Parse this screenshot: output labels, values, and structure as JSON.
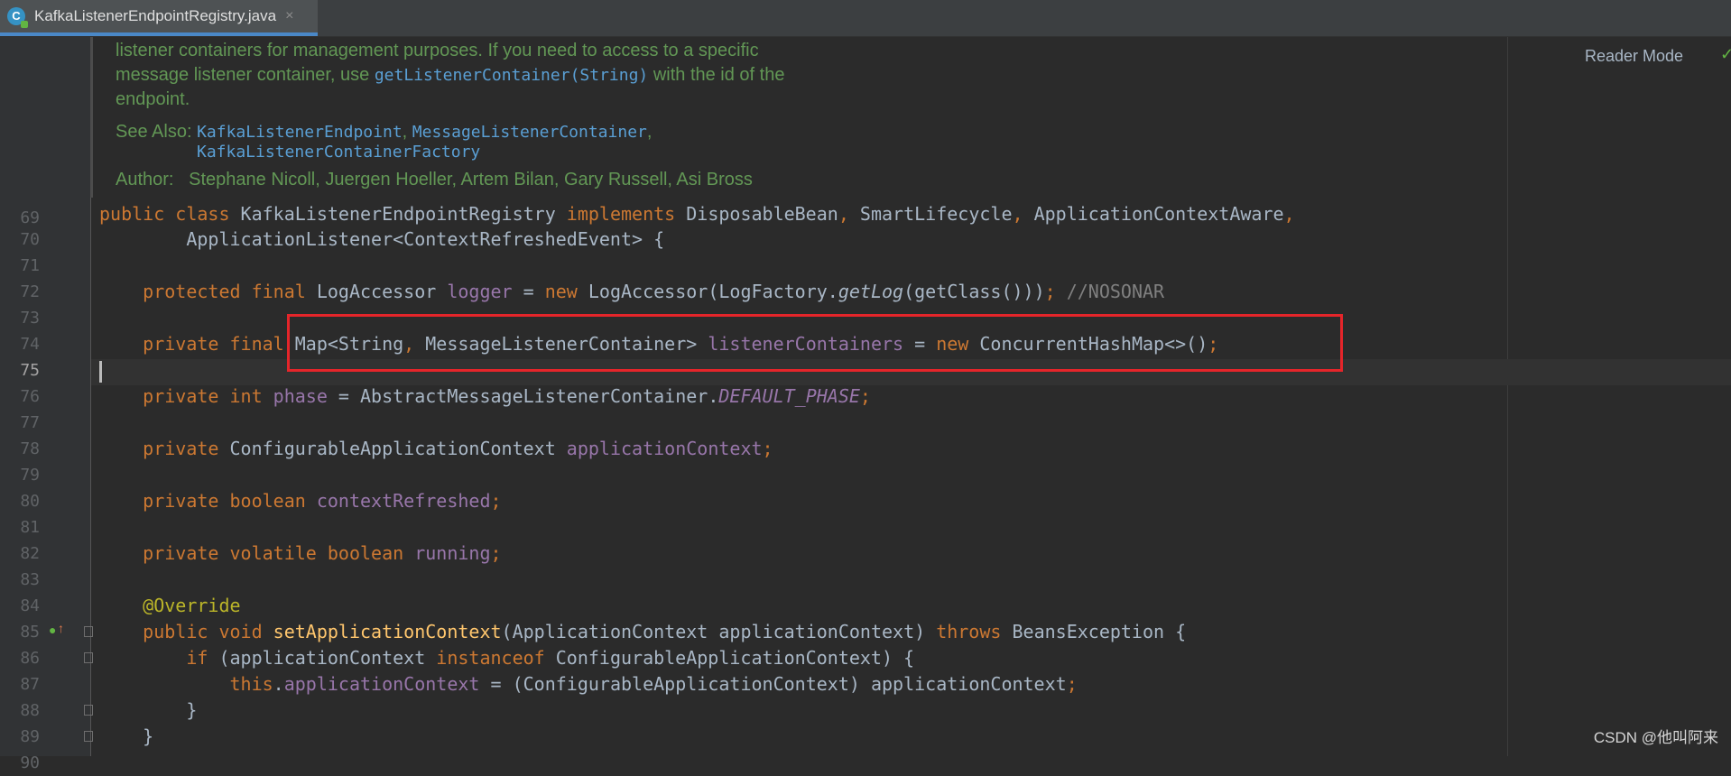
{
  "tab": {
    "icon_letter": "C",
    "title": "KafkaListenerEndpointRegistry.java",
    "close": "×"
  },
  "reader_mode": "Reader Mode",
  "javadoc": {
    "line1": "listener containers for management purposes. If you need to access to a specific",
    "line2_pre": "message listener container, use ",
    "line2_code": "getListenerContainer(String)",
    "line2_post": " with the id of the",
    "line3": "endpoint.",
    "see_also_label": "See Also:",
    "see_also_1": "KafkaListenerEndpoint",
    "see_also_sep1": ", ",
    "see_also_2": "MessageListenerContainer",
    "see_also_sep2": ",",
    "see_also_3": "KafkaListenerContainerFactory",
    "author_label": "Author:",
    "author_value": "Stephane Nicoll, Juergen Hoeller, Artem Bilan, Gary Russell, Asi Bross"
  },
  "line_numbers": [
    "69",
    "70",
    "71",
    "72",
    "73",
    "74",
    "75",
    "76",
    "77",
    "78",
    "79",
    "80",
    "81",
    "82",
    "83",
    "84",
    "85",
    "86",
    "87",
    "88",
    "89",
    "90"
  ],
  "code": {
    "l69": {
      "kw1": "public class ",
      "name": "KafkaListenerEndpointRegistry ",
      "kw2": "implements ",
      "t1": "DisposableBean",
      "c1": ", ",
      "t2": "SmartLifecycle",
      "c2": ", ",
      "t3": "ApplicationContextAware",
      "c3": ","
    },
    "l70": {
      "text": "ApplicationListener<ContextRefreshedEvent> {"
    },
    "l72": {
      "kw": "protected final ",
      "type": "LogAccessor ",
      "field": "logger",
      "eq": " = ",
      "kwnew": "new ",
      "call1": "LogAccessor(LogFactory.",
      "method": "getLog",
      "call2": "(getClass()))",
      "semi": "; ",
      "comment": "//NOSONAR"
    },
    "l74": {
      "kw": "private final ",
      "type": "Map<String",
      "comma": ", ",
      "type2": "MessageListenerContainer> ",
      "field": "listenerContainers",
      "eq": " = ",
      "kwnew": "new ",
      "call": "ConcurrentHashMap<>()",
      "semi": ";"
    },
    "l76": {
      "kw": "private int ",
      "field": "phase",
      "eq": " = AbstractMessageListenerContainer.",
      "const": "DEFAULT_PHASE",
      "semi": ";"
    },
    "l78": {
      "kw": "private ",
      "type": "ConfigurableApplicationContext ",
      "field": "applicationContext",
      "semi": ";"
    },
    "l80": {
      "kw": "private boolean ",
      "field": "contextRefreshed",
      "semi": ";"
    },
    "l82": {
      "kw": "private volatile boolean ",
      "field": "running",
      "semi": ";"
    },
    "l84": {
      "ann": "@Override"
    },
    "l85": {
      "kw": "public void ",
      "fn": "setApplicationContext",
      "args": "(ApplicationContext applicationContext) ",
      "kw2": "throws ",
      "exc": "BeansException {"
    },
    "l86": {
      "kw": "if ",
      "p1": "(applicationContext ",
      "kw2": "instanceof ",
      "p2": "ConfigurableApplicationContext) {"
    },
    "l87": {
      "kw": "this",
      "dot": ".",
      "field": "applicationContext",
      "rest": " = (ConfigurableApplicationContext) applicationContext",
      "semi": ";"
    },
    "l88": {
      "text": "}"
    },
    "l89": {
      "text": "}"
    }
  },
  "watermark": "CSDN @他叫阿来"
}
